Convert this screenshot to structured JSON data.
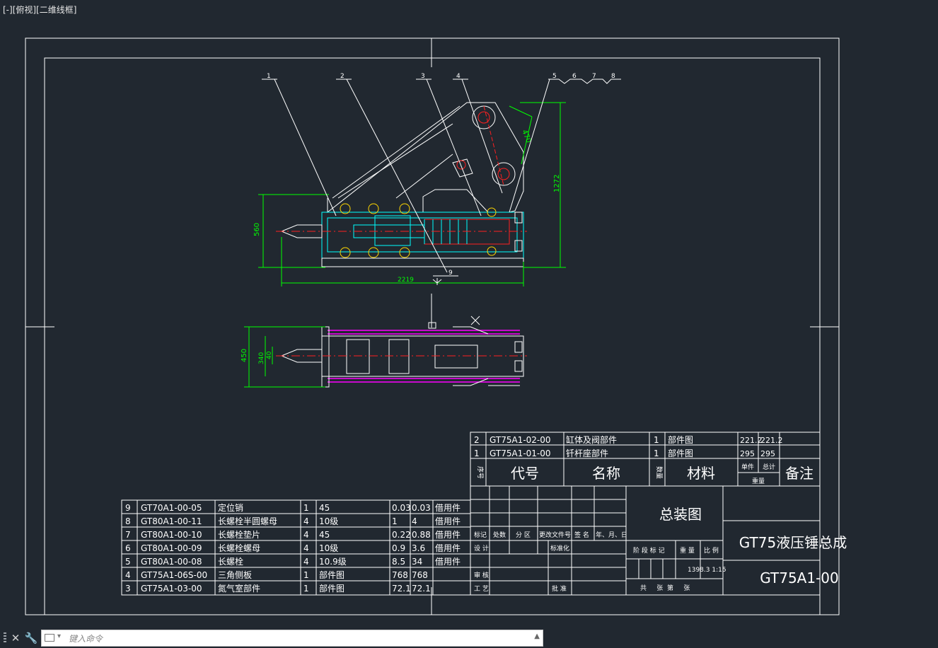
{
  "viewport": {
    "label": "[-][俯视][二维线框]"
  },
  "colors": {
    "background": "#212830",
    "linework": "#ffffff",
    "dimension": "#00ff00",
    "section": "#00ffff",
    "centerline": "#ff2020",
    "bolt": "#ffd700",
    "plate": "#ff00ff"
  },
  "balloons": [
    "1",
    "2",
    "3",
    "4",
    "5",
    "6",
    "7",
    "8",
    "9"
  ],
  "dimensions": {
    "overall_height": "1272",
    "body_height": "560",
    "overall_length": "2219",
    "link_offset": "470",
    "plan_width": "450",
    "plan_inner_a": "340",
    "plan_inner_b": "40"
  },
  "parts_upper": [
    {
      "no": "2",
      "code": "GT75A1-02-00",
      "name": "缸体及阀部件",
      "qty": "1",
      "material": "部件图",
      "unit_weight": "221.2",
      "total_weight": "221.2",
      "note": ""
    },
    {
      "no": "1",
      "code": "GT75A1-01-00",
      "name": "钎杆座部件",
      "qty": "1",
      "material": "部件图",
      "unit_weight": "295",
      "total_weight": "295",
      "note": ""
    }
  ],
  "parts_header": {
    "seq": "序号",
    "code": "代号",
    "name": "名称",
    "qty": "数量",
    "material": "材料",
    "unit": "单件",
    "total": "总计",
    "weight": "重量",
    "note": "备注"
  },
  "parts_lower": [
    {
      "no": "9",
      "code": "GT70A1-00-05",
      "name": "定位销",
      "qty": "1",
      "material": "45",
      "unit_weight": "0.03",
      "total_weight": "0.03",
      "note": "借用件"
    },
    {
      "no": "8",
      "code": "GT80A1-00-11",
      "name": "长螺栓半圆螺母",
      "qty": "4",
      "material": "10级",
      "unit_weight": "1",
      "total_weight": "4",
      "note": "借用件"
    },
    {
      "no": "7",
      "code": "GT80A1-00-10",
      "name": "长螺栓垫片",
      "qty": "4",
      "material": "45",
      "unit_weight": "0.22",
      "total_weight": "0.88",
      "note": "借用件"
    },
    {
      "no": "6",
      "code": "GT80A1-00-09",
      "name": "长螺栓螺母",
      "qty": "4",
      "material": "10级",
      "unit_weight": "0.9",
      "total_weight": "3.6",
      "note": "借用件"
    },
    {
      "no": "5",
      "code": "GT80A1-00-08",
      "name": "长螺栓",
      "qty": "4",
      "material": "10.9级",
      "unit_weight": "8.5",
      "total_weight": "34",
      "note": "借用件"
    },
    {
      "no": "4",
      "code": "GT75A1-06S-00",
      "name": "三角侧板",
      "qty": "1",
      "material": "部件图",
      "unit_weight": "768",
      "total_weight": "768",
      "note": ""
    },
    {
      "no": "3",
      "code": "GT75A1-03-00",
      "name": "氮气室部件",
      "qty": "1",
      "material": "部件图",
      "unit_weight": "72.1",
      "total_weight": "72.1",
      "note": ""
    }
  ],
  "title_block": {
    "drawing_name": "总装图",
    "product": "GT75液压锤总成",
    "drawing_no": "GT75A1-00",
    "weight_scale": "1398.3  1:15",
    "rev_headers": [
      "标记",
      "处数",
      "分 区",
      "更改文件号",
      "签 名",
      "年、月、日"
    ],
    "design": "设 计",
    "standard": "标准化",
    "review": "审 核",
    "process": "工 艺",
    "approve": "批 准",
    "stage_headers": [
      "阶 段 标 记",
      "重 量",
      "比 例"
    ],
    "sheets": "共     张  第     张"
  },
  "commandline": {
    "placeholder": "键入命令"
  }
}
